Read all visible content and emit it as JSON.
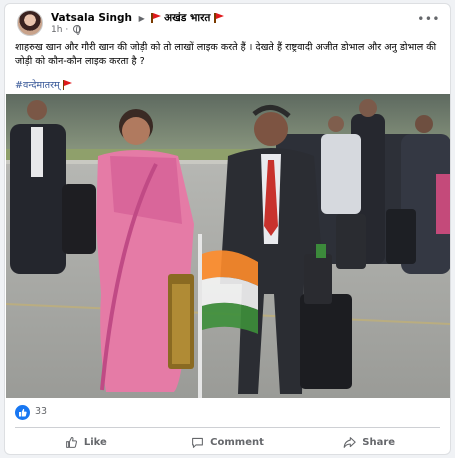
{
  "post": {
    "author": "Vatsala Singh",
    "group": "अखंड भारत",
    "time": "1h",
    "text": "शाहरुख खान और गौरी खान की जोड़ी को तो लाखों लाइक करते हैं । देखते हैं राष्ट्रवादी अजीत डोभाल और अनु डोभाल की जोड़ी को कौन-कौन लाइक करता है ?",
    "hashtag": "#वन्देमातरम्",
    "reactions_count": "33"
  },
  "actions": {
    "like": "Like",
    "comment": "Comment",
    "share": "Share"
  },
  "icons": {
    "avatar": "avatar-photo",
    "group_arrow": "caret-right-icon",
    "flag": "saffron-flag-icon",
    "privacy": "globe-icon",
    "more": "more-horizontal-icon",
    "reaction": "thumbs-up-icon",
    "like": "thumbs-up-outline-icon",
    "comment": "speech-bubble-icon",
    "share": "share-arrow-icon"
  },
  "colors": {
    "link": "#385898",
    "facebook_blue": "#1877f2",
    "secondary_text": "#65676b",
    "flag_red": "#e0191c"
  }
}
